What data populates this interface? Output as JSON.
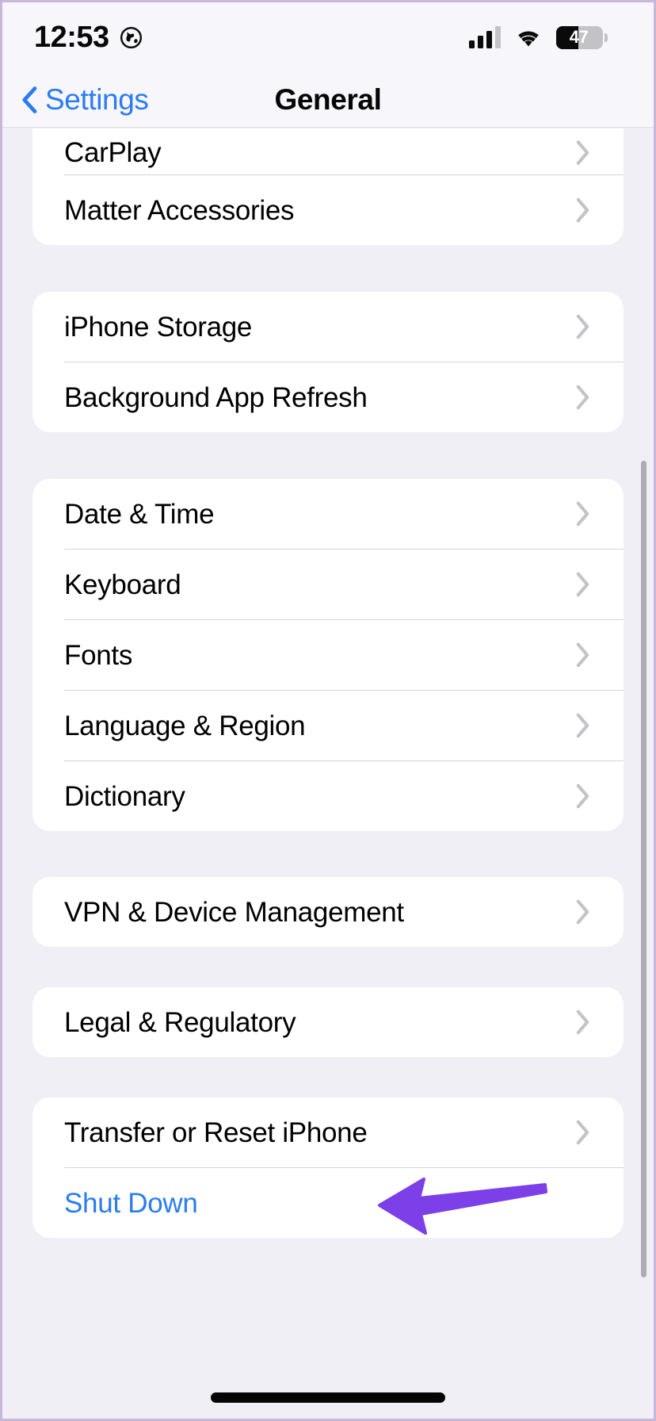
{
  "status_bar": {
    "time": "12:53",
    "globe_icon": "globe-icon",
    "cellular_icon": "cellular-signal-icon",
    "cellular_bars_filled": 3,
    "cellular_bars_total": 4,
    "wifi_icon": "wifi-icon",
    "battery_percent": "47",
    "battery_level": 47,
    "battery_icon": "battery-icon"
  },
  "nav_bar": {
    "back_label": "Settings",
    "back_icon": "chevron-left-icon",
    "title": "General",
    "accent_color": "#2b7cf0"
  },
  "groups": [
    {
      "clipped_top": true,
      "rows": [
        {
          "label": "CarPlay",
          "chevron": true,
          "clip": true
        },
        {
          "label": "Matter Accessories",
          "chevron": true
        }
      ]
    },
    {
      "rows": [
        {
          "label": "iPhone Storage",
          "chevron": true
        },
        {
          "label": "Background App Refresh",
          "chevron": true
        }
      ]
    },
    {
      "rows": [
        {
          "label": "Date & Time",
          "chevron": true
        },
        {
          "label": "Keyboard",
          "chevron": true
        },
        {
          "label": "Fonts",
          "chevron": true
        },
        {
          "label": "Language & Region",
          "chevron": true
        },
        {
          "label": "Dictionary",
          "chevron": true
        }
      ]
    },
    {
      "rows": [
        {
          "label": "VPN & Device Management",
          "chevron": true
        }
      ]
    },
    {
      "rows": [
        {
          "label": "Legal & Regulatory",
          "chevron": true
        }
      ]
    },
    {
      "rows": [
        {
          "label": "Transfer or Reset iPhone",
          "chevron": true
        },
        {
          "label": "Shut Down",
          "chevron": false,
          "link": true
        }
      ]
    }
  ],
  "annotation": {
    "type": "arrow",
    "direction": "left",
    "color": "#7c3fe8",
    "points_at": "Transfer or Reset iPhone"
  },
  "scrollbar": {
    "visible": true,
    "color": "#adacb2"
  },
  "home_indicator": {
    "visible": true,
    "color": "#050505"
  },
  "colors": {
    "background": "#f0eff5",
    "card": "#ffffff",
    "separator": "#d5d4da",
    "label": "#000000",
    "link": "#2b7cf0",
    "chevron": "#c3c3c8"
  }
}
